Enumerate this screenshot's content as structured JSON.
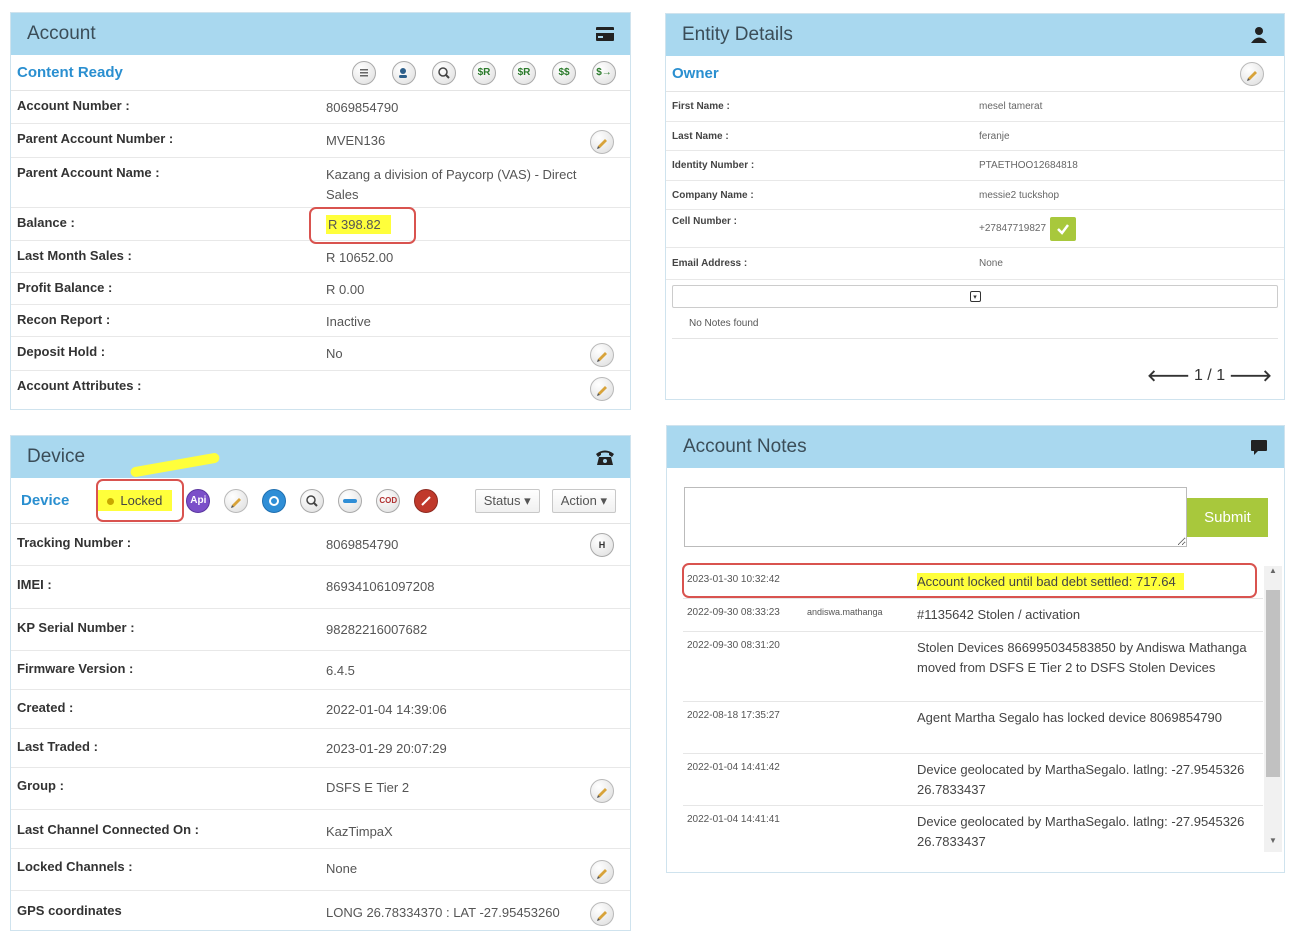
{
  "account": {
    "title": "Account",
    "status_label": "Content Ready",
    "rows": [
      {
        "label": "Account Number :",
        "value": "8069854790"
      },
      {
        "label": "Parent Account Number :",
        "value": "MVEN136"
      },
      {
        "label": "Parent Account Name :",
        "value": "Kazang a division of Paycorp (VAS) - Direct Sales"
      },
      {
        "label": "Balance :",
        "value": "R 398.82"
      },
      {
        "label": "Last Month Sales :",
        "value": "R 10652.00"
      },
      {
        "label": "Profit Balance :",
        "value": "R 0.00"
      },
      {
        "label": "Recon Report :",
        "value": "Inactive"
      },
      {
        "label": "Deposit Hold :",
        "value": "No"
      },
      {
        "label": "Account Attributes :",
        "value": ""
      }
    ]
  },
  "device": {
    "title": "Device",
    "sub_title": "Device",
    "locked_label": "Locked",
    "api_label": "Api",
    "cod_label": "COD",
    "status_btn": "Status",
    "action_btn": "Action",
    "rows": [
      {
        "label": "Tracking Number :",
        "value": "8069854790"
      },
      {
        "label": "IMEI :",
        "value": "869341061097208"
      },
      {
        "label": "KP Serial Number :",
        "value": "98282216007682"
      },
      {
        "label": "Firmware Version :",
        "value": "6.4.5"
      },
      {
        "label": "Created :",
        "value": "2022-01-04 14:39:06"
      },
      {
        "label": "Last Traded :",
        "value": "2023-01-29 20:07:29"
      },
      {
        "label": "Group :",
        "value": "DSFS E Tier 2"
      },
      {
        "label": "Last Channel Connected On :",
        "value": "KazTimpaX"
      },
      {
        "label": "Locked Channels :",
        "value": "None"
      },
      {
        "label": "GPS coordinates",
        "value": "LONG 26.78334370 : LAT -27.95453260"
      }
    ]
  },
  "entity": {
    "title": "Entity Details",
    "sub_title": "Owner",
    "rows": [
      {
        "label": "First Name :",
        "value": "mesel tamerat"
      },
      {
        "label": "Last Name :",
        "value": "feranje"
      },
      {
        "label": "Identity Number :",
        "value": "PTAETHOO12684818"
      },
      {
        "label": "Company Name :",
        "value": "messie2 tuckshop"
      },
      {
        "label": "Cell Number :",
        "value": "+27847719827"
      },
      {
        "label": "Email Address :",
        "value": "None"
      }
    ],
    "no_notes": "No Notes found",
    "pagination": "1 / 1"
  },
  "notes": {
    "title": "Account Notes",
    "submit_label": "Submit",
    "items": [
      {
        "date": "2023-01-30 10:32:42",
        "user": "",
        "text": "Account locked until bad debt settled: 717.64"
      },
      {
        "date": "2022-09-30 08:33:23",
        "user": "andiswa.mathanga",
        "text": "#1135642 Stolen / activation"
      },
      {
        "date": "2022-09-30 08:31:20",
        "user": "",
        "text": "Stolen Devices 866995034583850 by Andiswa Mathanga moved from DSFS E Tier 2 to DSFS Stolen Devices"
      },
      {
        "date": "2022-08-18 17:35:27",
        "user": "",
        "text": "Agent Martha Segalo has locked device 8069854790"
      },
      {
        "date": "2022-01-04 14:41:42",
        "user": "",
        "text": "Device geolocated by MarthaSegalo. latlng: -27.9545326 26.7833437"
      },
      {
        "date": "2022-01-04 14:41:41",
        "user": "",
        "text": "Device geolocated by MarthaSegalo. latlng: -27.9545326 26.7833437"
      }
    ]
  },
  "colors": {
    "header_bg": "#a9d8ef",
    "link_blue": "#2a8fd0",
    "highlight": "#ffff3b",
    "annotation_red": "#d9534f",
    "submit_green": "#a8c83c"
  }
}
